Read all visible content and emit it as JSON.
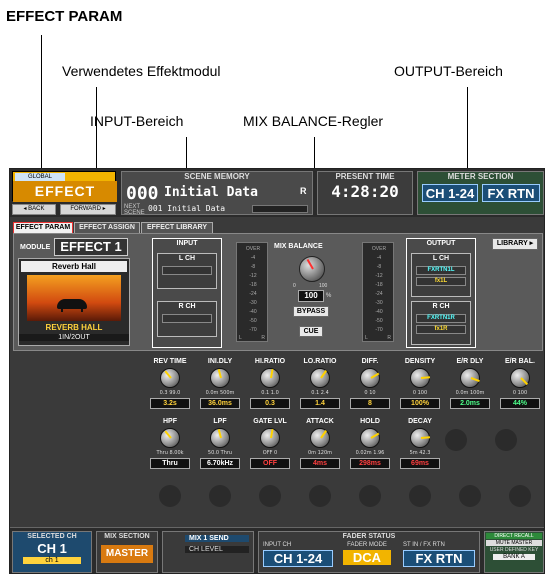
{
  "callouts": {
    "effect_param": "EFFECT PARAM",
    "module_used": "Verwendetes Effektmodul",
    "output_area": "OUTPUT-Bereich",
    "input_area": "INPUT-Bereich",
    "mix_balance": "MIX BALANCE-Regler"
  },
  "topbar": {
    "function_small": "GLOBAL",
    "function_label": "EFFECT",
    "back_label": "BACK",
    "forward_label": "FORWARD",
    "scene_header": "SCENE MEMORY",
    "scene_number": "000",
    "scene_name": "Initial Data",
    "scene_flag": "R",
    "next_scene_label": "NEXT SCENE",
    "next_scene_name": "001 Initial Data",
    "time_header": "PRESENT TIME",
    "time_value": "4:28:20",
    "meter_header": "METER SECTION",
    "meter_ch": "CH 1-24",
    "meter_fx": "FX RTN"
  },
  "tabs": [
    "EFFECT PARAM",
    "EFFECT ASSIGN",
    "EFFECT LIBRARY"
  ],
  "module": {
    "label": "MODULE",
    "value": "EFFECT 1",
    "effect_title": "Reverb Hall",
    "effect_name": "REVERB HALL",
    "io_config": "1IN/2OUT",
    "library_button": "LIBRARY"
  },
  "input": {
    "header": "INPUT",
    "l_label": "L CH",
    "r_label": "R CH"
  },
  "mix_balance": {
    "label": "MIX BALANCE",
    "min": "0",
    "max": "100",
    "value": "100",
    "unit": "%",
    "bypass": "BYPASS",
    "cue": "CUE"
  },
  "meter_scale": [
    "OVER",
    "-4",
    "-8",
    "-12",
    "-18",
    "-24",
    "-30",
    "-40",
    "-50",
    "-70"
  ],
  "meter_lr": [
    "L",
    "R"
  ],
  "output": {
    "header": "OUTPUT",
    "l_label": "L CH",
    "l_dest1": "FXRTN1L",
    "l_dest2": "fx1L",
    "r_label": "R CH",
    "r_dest1": "FXRTN1R",
    "r_dest2": "fx1R"
  },
  "params_row1": [
    {
      "label": "REV TIME",
      "min": "0.3",
      "max": "99.0",
      "value": "3.2s",
      "color": "#ffd23c"
    },
    {
      "label": "INI.DLY",
      "min": "0.0m",
      "max": "500m",
      "value": "36.0ms",
      "color": "#ffd23c"
    },
    {
      "label": "HI.RATIO",
      "min": "0.1",
      "max": "1.0",
      "value": "0.3",
      "color": "#ffd23c"
    },
    {
      "label": "LO.RATIO",
      "min": "0.1",
      "max": "2.4",
      "value": "1.4",
      "color": "#ffd23c"
    },
    {
      "label": "DIFF.",
      "min": "0",
      "max": "10",
      "value": "8",
      "color": "#ffd23c"
    },
    {
      "label": "DENSITY",
      "min": "0",
      "max": "100",
      "value": "100%",
      "color": "#ffd23c"
    },
    {
      "label": "E/R DLY",
      "min": "0.0m",
      "max": "100m",
      "value": "2.0ms",
      "color": "#4dff8a"
    },
    {
      "label": "E/R BAL.",
      "min": "0",
      "max": "100",
      "value": "44%",
      "color": "#4dff8a"
    }
  ],
  "params_row2": [
    {
      "label": "HPF",
      "min": "Thru",
      "max": "8.00k",
      "value": "Thru",
      "color": "#ffffff"
    },
    {
      "label": "LPF",
      "min": "50.0",
      "max": "Thru",
      "value": "6.70kHz",
      "color": "#ffffff"
    },
    {
      "label": "GATE LVL",
      "min": "OFF",
      "max": "0",
      "value": "OFF",
      "color": "#ff4040"
    },
    {
      "label": "ATTACK",
      "min": "0m",
      "max": "120m",
      "value": "4ms",
      "color": "#ff4040"
    },
    {
      "label": "HOLD",
      "min": "0.02m",
      "max": "1.96",
      "value": "298ms",
      "color": "#ff4040"
    },
    {
      "label": "DECAY",
      "min": "5m",
      "max": "42.3",
      "value": "69ms",
      "color": "#ff4040"
    }
  ],
  "bottombar": {
    "selected_header": "SELECTED CH",
    "selected_value": "CH 1",
    "selected_sub": "ch 1",
    "mix_header": "MIX SECTION",
    "mix_value": "MASTER",
    "send_label": "MIX 1 SEND",
    "level_label": "CH LEVEL",
    "fader_header": "FADER STATUS",
    "input_ch_label": "INPUT CH",
    "input_ch_value": "CH 1-24",
    "fader_mode_label": "FADER MODE",
    "fader_mode_value": "DCA",
    "st_label": "ST IN / FX RTN",
    "st_value": "FX RTN",
    "direct_recall": "DIRECT RECALL",
    "mute_master": "MUTE MASTER",
    "user_key": "USER DEFINED KEY",
    "bank": "BANK A"
  }
}
